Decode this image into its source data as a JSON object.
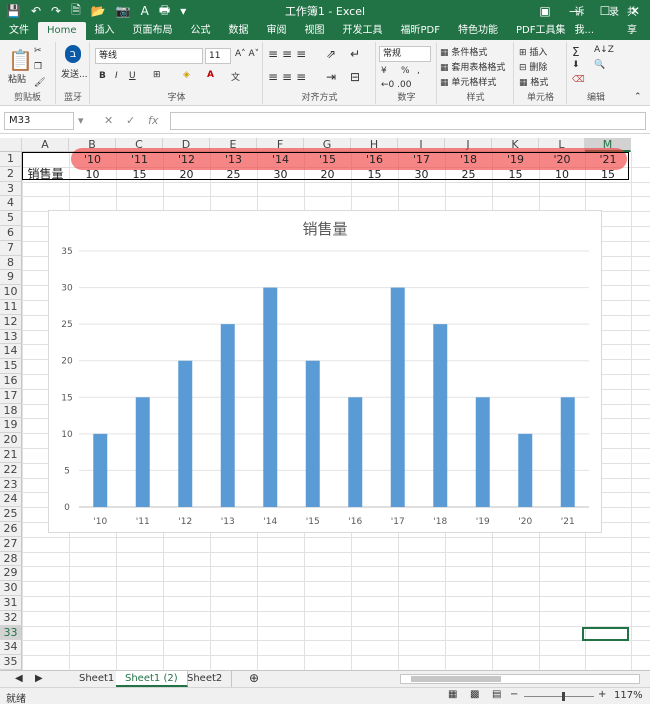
{
  "window": {
    "title": "工作簿1 - Excel"
  },
  "tabs": [
    {
      "label": "文件"
    },
    {
      "label": "Home"
    },
    {
      "label": "插入"
    },
    {
      "label": "页面布局"
    },
    {
      "label": "公式"
    },
    {
      "label": "数据"
    },
    {
      "label": "审阅"
    },
    {
      "label": "视图"
    },
    {
      "label": "开发工具"
    },
    {
      "label": "福昕PDF"
    },
    {
      "label": "特色功能"
    },
    {
      "label": "PDF工具集"
    }
  ],
  "tell_me": "告诉我...",
  "login": "登录",
  "share": "共享",
  "ribbon": {
    "clipboard": {
      "paste": "粘贴",
      "group": "剪贴板"
    },
    "bluetooth": {
      "send": "发送...",
      "group": "蓝牙"
    },
    "font": {
      "name": "等线",
      "size": "11",
      "group": "字体",
      "bold": "B",
      "italic": "I",
      "underline": "U"
    },
    "alignment": {
      "group": "对齐方式"
    },
    "number": {
      "format": "常规",
      "group": "数字",
      "percent": "%"
    },
    "styles": {
      "conditional": "条件格式",
      "table": "套用表格格式",
      "cell": "单元格样式",
      "group": "样式"
    },
    "cells": {
      "insert": "插入",
      "delete": "删除",
      "format": "格式",
      "group": "单元格"
    },
    "editing": {
      "group": "编辑"
    }
  },
  "formula_bar": {
    "name_box": "M33",
    "value": ""
  },
  "columns": [
    "A",
    "B",
    "C",
    "D",
    "E",
    "F",
    "G",
    "H",
    "I",
    "J",
    "K",
    "L",
    "M"
  ],
  "rows": [
    "1",
    "2",
    "3",
    "4",
    "5",
    "6",
    "7",
    "8",
    "9",
    "10",
    "11",
    "12",
    "13",
    "14",
    "15",
    "16",
    "17",
    "18",
    "19",
    "20",
    "21",
    "22",
    "23",
    "24",
    "25",
    "26",
    "27",
    "28",
    "29",
    "30",
    "31",
    "32",
    "33",
    "34",
    "35"
  ],
  "cells": {
    "row1": [
      "'10",
      "'11",
      "'12",
      "'13",
      "'14",
      "'15",
      "'16",
      "'17",
      "'18",
      "'19",
      "'20",
      "'21"
    ],
    "row2_label": "销售量",
    "row2": [
      "10",
      "15",
      "20",
      "25",
      "30",
      "20",
      "15",
      "30",
      "25",
      "15",
      "10",
      "15"
    ]
  },
  "chart_data": {
    "type": "bar",
    "title": "销售量",
    "categories": [
      "'10",
      "'11",
      "'12",
      "'13",
      "'14",
      "'15",
      "'16",
      "'17",
      "'18",
      "'19",
      "'20",
      "'21"
    ],
    "values": [
      10,
      15,
      20,
      25,
      30,
      20,
      15,
      30,
      25,
      15,
      10,
      15
    ],
    "ylim": [
      0,
      35
    ],
    "yticks": [
      0,
      5,
      10,
      15,
      20,
      25,
      30,
      35
    ],
    "grid": true,
    "bar_color": "#5b9bd5"
  },
  "sheets": [
    {
      "label": "Sheet1"
    },
    {
      "label": "Sheet1 (2)"
    },
    {
      "label": "Sheet2"
    }
  ],
  "status": {
    "mode": "就绪",
    "zoom": "117%"
  },
  "colors": {
    "accent": "#217346",
    "highlight": "#f03c3c"
  }
}
